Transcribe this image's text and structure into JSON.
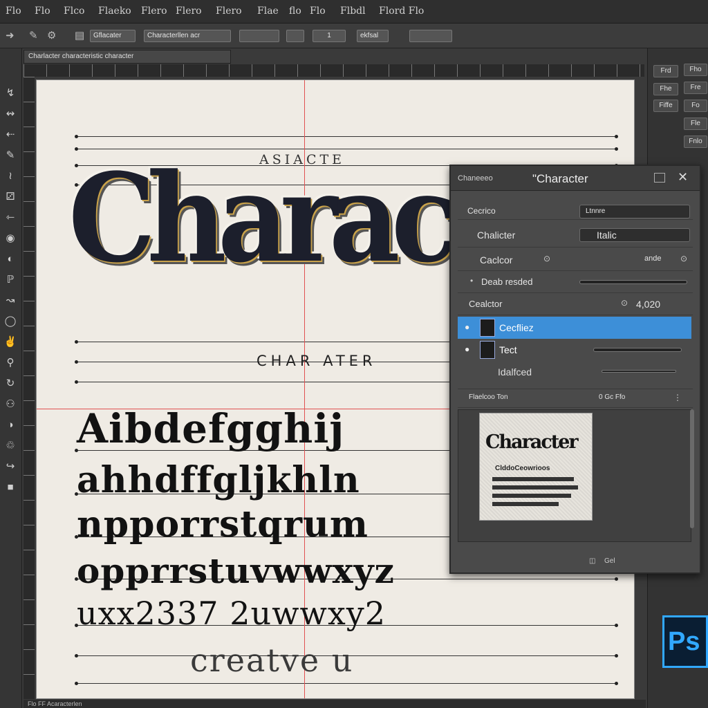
{
  "menubar": {
    "items": [
      "Flo",
      "Flo",
      "Flco",
      "Flaeko",
      "Flero",
      "Flero",
      "Flero",
      "Flae",
      "flo",
      "Flo",
      "Flbdl",
      "Flord Flo"
    ]
  },
  "optionsbar": {
    "field_1": "Gflacater",
    "field_2": "Characterllen acr",
    "field_3": "1",
    "field_4": "ekfsal"
  },
  "document": {
    "tab_title": "Charlacter characteristic character",
    "status": "Flo  FF  Acaracterlen"
  },
  "canvas": {
    "small_caps_top": "ASIACTE",
    "hero_word": "Character",
    "sub_caps": "CHAR ATER",
    "alpha_lines": [
      "Aibdefgghij",
      "ahhdffgljkhln",
      "npporrstqrum",
      "opprrstuvwwxyz",
      "uxx2337 2uwwxy2"
    ],
    "bottom_word": "creatve u"
  },
  "panel": {
    "tab_label": "Chaneeeo",
    "title": "ʺCharacter",
    "rows": {
      "row1_label": "Cecrico",
      "row1_value": "Ltnnre",
      "row2_label": "Chalicter",
      "row2_value": "Italic",
      "row3_label": "Caclcor",
      "row3_value": "ande",
      "row4_label": "Deab resded",
      "row5_label": "Cealctor",
      "row5_value": "4,020"
    },
    "layers": [
      {
        "name": "Cecfliez",
        "selected": true
      },
      {
        "name": "Tect",
        "selected": false
      },
      {
        "name": "Idalfced",
        "selected": false
      }
    ],
    "section_label": "Flaelcoo Ton",
    "section_value": "0  Gc Ffo",
    "preview": {
      "title": "Character",
      "caption": "ClddoCeowrioos"
    },
    "footer": "Gel"
  },
  "dock": {
    "buttons": [
      "Frd",
      "Fhe",
      "Fiffe",
      "Fho",
      "Fre",
      "Fo",
      "Fle",
      "Fnlo"
    ],
    "ps_label": "Ps"
  },
  "colors": {
    "accent": "#3d8fd8",
    "guide": "#e05050",
    "ps_brand": "#31a8ff"
  }
}
